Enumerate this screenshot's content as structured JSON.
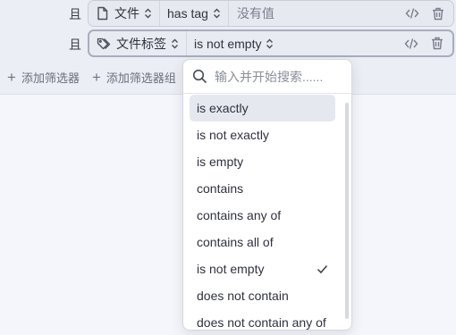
{
  "filters": [
    {
      "conjunction": "且",
      "property": "文件",
      "property_icon": "file-icon",
      "operator": "has tag",
      "value_placeholder": "没有值"
    },
    {
      "conjunction": "且",
      "property": "文件标签",
      "property_icon": "tags-icon",
      "operator": "is not empty",
      "value_placeholder": ""
    }
  ],
  "add_bar": {
    "add_filter": "添加筛选器",
    "add_filter_group": "添加筛选器组"
  },
  "dropdown": {
    "search_placeholder": "输入并开始搜索......",
    "selected": "is not empty",
    "options": [
      "is exactly",
      "is not exactly",
      "is empty",
      "contains",
      "contains any of",
      "contains all of",
      "is not empty",
      "does not contain",
      "does not contain any of"
    ]
  },
  "colors": {
    "background": "#f5f6fb",
    "row_background": "#e7e9f1",
    "highlight": "#e6e8ef"
  }
}
